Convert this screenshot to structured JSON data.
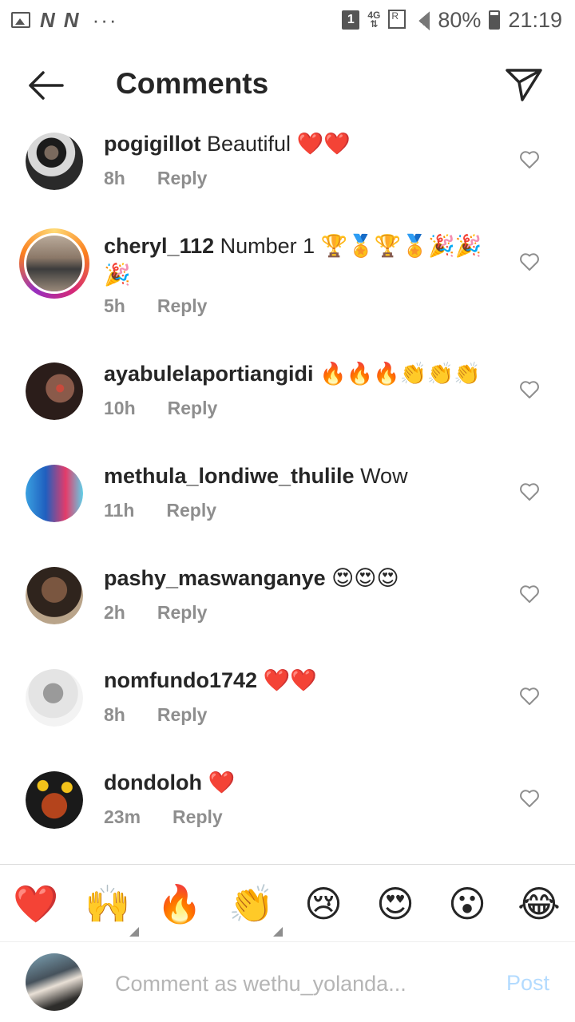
{
  "status_bar": {
    "sim_slot": "1",
    "network_type": "4G",
    "roaming": "R",
    "battery": "80%",
    "time": "21:19",
    "left_icons": [
      "image-icon",
      "n-notification-icon",
      "n-notification-icon",
      "more-dots-icon"
    ]
  },
  "header": {
    "title": "Comments",
    "back_icon": "back-arrow-icon",
    "send_icon": "send-icon"
  },
  "comments": [
    {
      "username": "pogigillot",
      "text": "Beautiful ❤️❤️",
      "time": "8h",
      "reply_label": "Reply",
      "has_story_ring": false,
      "avatar_color": "#3a3a3a"
    },
    {
      "username": "cheryl_112",
      "text": "Number 1 🏆🏅🏆🏅🎉🎉🎉",
      "time": "5h",
      "reply_label": "Reply",
      "has_story_ring": true,
      "avatar_color": "#6b5a4c"
    },
    {
      "username": "ayabulelaportiangidi",
      "text": "🔥🔥🔥👏👏👏",
      "time": "10h",
      "reply_label": "Reply",
      "has_story_ring": false,
      "avatar_color": "#4a2a24"
    },
    {
      "username": "methula_londiwe_thulile",
      "text": "Wow",
      "time": "11h",
      "reply_label": "Reply",
      "has_story_ring": false,
      "avatar_color": "#2e7fc9"
    },
    {
      "username": "pashy_maswanganye",
      "text": "😍😍😍",
      "time": "2h",
      "reply_label": "Reply",
      "has_story_ring": false,
      "avatar_color": "#5a4232"
    },
    {
      "username": "nomfundo1742",
      "text": "❤️❤️",
      "time": "8h",
      "reply_label": "Reply",
      "has_story_ring": false,
      "avatar_color": "#d4d4d4"
    },
    {
      "username": "dondoloh",
      "text": "❤️",
      "time": "23m",
      "reply_label": "Reply",
      "has_story_ring": false,
      "avatar_color": "#8a2a10"
    }
  ],
  "emoji_bar": [
    "❤️",
    "🙌",
    "🔥",
    "👏",
    "😢",
    "😍",
    "😮",
    "😂"
  ],
  "composer": {
    "placeholder": "Comment as wethu_yolanda...",
    "post_label": "Post",
    "post_color": "#b3dbff"
  }
}
